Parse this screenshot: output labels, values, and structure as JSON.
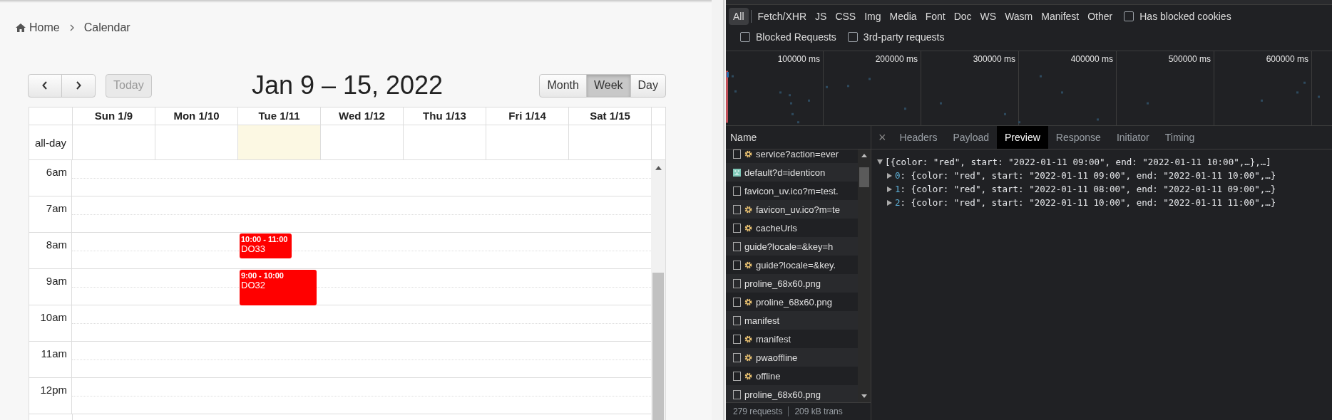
{
  "breadcrumb": [
    {
      "label": "Home",
      "kind": "home"
    },
    {
      "label": "Calendar",
      "kind": "page"
    }
  ],
  "calendar": {
    "nav": [
      {
        "kind": "prev"
      },
      {
        "kind": "next"
      }
    ],
    "today_button": {
      "label": "Today",
      "disabled": true
    },
    "title": "Jan 9 – 15, 2022",
    "views": [
      {
        "label": "Month",
        "selected": false
      },
      {
        "label": "Week",
        "selected": true
      },
      {
        "label": "Day",
        "selected": false
      }
    ],
    "allday_label": "all-day",
    "days": [
      {
        "label": "Sun 1/9",
        "today": false
      },
      {
        "label": "Mon 1/10",
        "today": false
      },
      {
        "label": "Tue 1/11",
        "today": true
      },
      {
        "label": "Wed 1/12",
        "today": false
      },
      {
        "label": "Thu 1/13",
        "today": false
      },
      {
        "label": "Fri 1/14",
        "today": false
      },
      {
        "label": "Sat 1/15",
        "today": false
      }
    ],
    "hours": [
      {
        "label": "6am"
      },
      {
        "label": "7am"
      },
      {
        "label": "8am",
        "cells": [
          {},
          {},
          {
            "events": [
              {
                "kind": "compact",
                "time": "10:00 - 11:00",
                "title": "DO33",
                "color": "#ff0000"
              }
            ]
          }
        ]
      },
      {
        "label": "9am",
        "cells": [
          {},
          {},
          {
            "events": [
              {
                "kind": "full",
                "time": "9:00 - 10:00",
                "title": "DO32",
                "color": "#ff0000"
              }
            ]
          }
        ]
      },
      {
        "label": "10am"
      },
      {
        "label": "11am"
      },
      {
        "label": "12pm"
      }
    ]
  },
  "devtools": {
    "filters": [
      {
        "label": "All",
        "selected": true
      },
      {
        "label": "Fetch/XHR",
        "selected": false
      },
      {
        "label": "JS",
        "selected": false
      },
      {
        "label": "CSS",
        "selected": false
      },
      {
        "label": "Img",
        "selected": false
      },
      {
        "label": "Media",
        "selected": false
      },
      {
        "label": "Font",
        "selected": false
      },
      {
        "label": "Doc",
        "selected": false
      },
      {
        "label": "WS",
        "selected": false
      },
      {
        "label": "Wasm",
        "selected": false
      },
      {
        "label": "Manifest",
        "selected": false
      },
      {
        "label": "Other",
        "selected": false
      }
    ],
    "options": [
      {
        "label": "Has blocked cookies",
        "checked": false
      }
    ],
    "more_options": [
      {
        "label": "Blocked Requests",
        "checked": false
      },
      {
        "label": "3rd-party requests",
        "checked": false
      }
    ],
    "timeline_ticks": [
      "100000 ms",
      "200000 ms",
      "300000 ms",
      "400000 ms",
      "500000 ms",
      "600000 ms"
    ],
    "name_header": "Name",
    "requests": [
      {
        "name": "service?action=ever",
        "kind": "worker"
      },
      {
        "name": "default?d=identicon",
        "kind": "image"
      },
      {
        "name": "favicon_uv.ico?m=test.",
        "kind": "plain"
      },
      {
        "name": "favicon_uv.ico?m=te",
        "kind": "worker"
      },
      {
        "name": "cacheUrls",
        "kind": "worker"
      },
      {
        "name": "guide?locale=&key=h",
        "kind": "plain"
      },
      {
        "name": "guide?locale=&key.",
        "kind": "worker"
      },
      {
        "name": "proline_68x60.png",
        "kind": "plain"
      },
      {
        "name": "proline_68x60.png",
        "kind": "worker"
      },
      {
        "name": "manifest",
        "kind": "plain"
      },
      {
        "name": "manifest",
        "kind": "worker"
      },
      {
        "name": "pwaoffline",
        "kind": "worker"
      },
      {
        "name": "offline",
        "kind": "worker"
      },
      {
        "name": "proline_68x60.png",
        "kind": "plain"
      }
    ],
    "footer": [
      "279 requests",
      "209 kB trans"
    ],
    "close_label": "×",
    "tabs": [
      {
        "label": "Headers",
        "selected": false
      },
      {
        "label": "Payload",
        "selected": false
      },
      {
        "label": "Preview",
        "selected": true
      },
      {
        "label": "Response",
        "selected": false
      },
      {
        "label": "Initiator",
        "selected": false
      },
      {
        "label": "Timing",
        "selected": false
      }
    ],
    "preview": {
      "text": "[{color: \"red\", start: \"2022-01-11 09:00\", end: \"2022-01-11 10:00\",…},…]",
      "expanded": true,
      "children": [
        {
          "index": "0",
          "text": ": {color: \"red\", start: \"2022-01-11 09:00\", end: \"2022-01-11 10:00\",…}",
          "expanded": false
        },
        {
          "index": "1",
          "text": ": {color: \"red\", start: \"2022-01-11 08:00\", end: \"2022-01-11 09:00\",…}",
          "expanded": false
        },
        {
          "index": "2",
          "text": ": {color: \"red\", start: \"2022-01-11 10:00\", end: \"2022-01-11 11:00\",…}",
          "expanded": false
        }
      ]
    }
  }
}
